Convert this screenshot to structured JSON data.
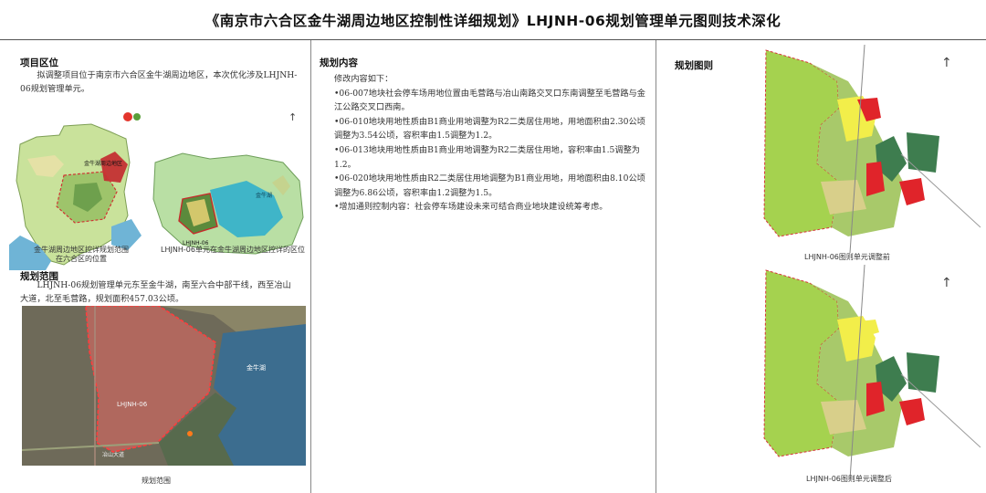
{
  "document": {
    "title": "《南京市六合区金牛湖周边地区控制性详细规划》LHJNH-06规划管理单元图则技术深化"
  },
  "project_location": {
    "heading": "项目区位",
    "text": "拟调整项目位于南京市六合区金牛湖周边地区，本次优化涉及LHJNH-06规划管理单元。",
    "map_left_caption": "金牛湖周边地区控详规划范围在六合区的位置",
    "map_left_label": "金牛湖周边地区",
    "map_right_caption": "LHJNH-06单元在金牛湖周边地区控详的区位",
    "map_right_labels": [
      "金牛湖",
      "LHJNH-06"
    ]
  },
  "planning_scope": {
    "heading": "规划范围",
    "text": "LHJNH-06规划管理单元东至金牛湖，南至六合中部干线，西至冶山大道，北至毛营路，规划面积457.03公顷。",
    "map_caption": "规划范围",
    "map_labels": [
      "冶山大道",
      "LHJNH-06",
      "金牛湖"
    ]
  },
  "planning_content": {
    "heading": "规划内容",
    "items": [
      "修改内容如下：",
      "•06-007地块社会停车场用地位置由毛营路与冶山南路交叉口东南调整至毛营路与金江公路交叉口西南。",
      "•06-010地块用地性质由B1商业用地调整为R2二类居住用地，用地面积由2.30公顷调整为3.54公顷，容积率由1.5调整为1.2。",
      "•06-013地块用地性质由B1商业用地调整为R2二类居住用地，容积率由1.5调整为1.2。",
      "•06-020地块用地性质由R2二类居住用地调整为B1商业用地，用地面积由8.10公顷调整为6.86公顷，容积率由1.2调整为1.5。",
      "•增加通则控制内容：社会停车场建设未来可结合商业地块建设统筹考虑。"
    ]
  },
  "planning_drawings": {
    "heading": "规划图则",
    "before_caption": "LHJNH-06图则单元调整前",
    "after_caption": "LHJNH-06图则单元调整后"
  },
  "colors": {
    "lake": "#4aa3c8",
    "green": "#a6d35a",
    "dark_green": "#3e7d4f",
    "residential": "#f2ee4a",
    "commercial": "#e0242a",
    "boundary": "#d8343a"
  }
}
